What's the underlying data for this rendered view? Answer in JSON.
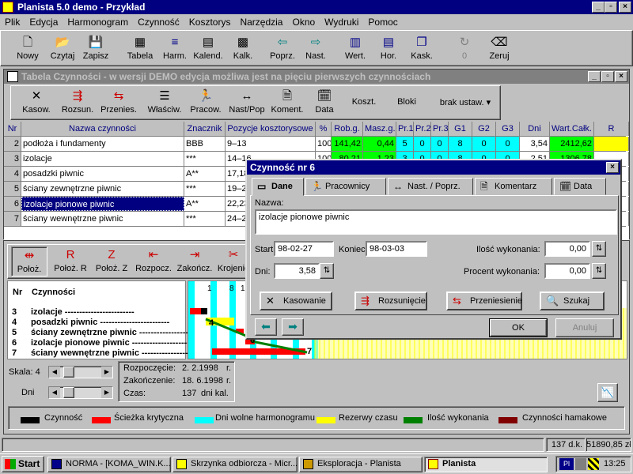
{
  "app": {
    "title": "Planista 5.0 demo - Przykład"
  },
  "menu": [
    "Plik",
    "Edycja",
    "Harmonogram",
    "Czynność",
    "Kosztorys",
    "Narzędzia",
    "Okno",
    "Wydruki",
    "Pomoc"
  ],
  "toolbar": [
    "Nowy",
    "Czytaj",
    "Zapisz",
    "Tabela",
    "Harm.",
    "Kalend.",
    "Kalk.",
    "Poprz.",
    "Nast.",
    "Wert.",
    "Hor.",
    "Kask.",
    "0",
    "Zeruj"
  ],
  "table_window": {
    "title": "Tabela Czynności - w wersji DEMO edycja możliwa jest na pięciu pierwszych czynnościach",
    "toolbar": [
      "Kasow.",
      "Rozsun.",
      "Przenies.",
      "Właściw.",
      "Pracow.",
      "Nast/Pop",
      "Koment.",
      "Data",
      "Koszt.",
      "Bloki"
    ],
    "filter": "brak ustaw.",
    "headers": [
      "Nr",
      "Nazwa czynności",
      "Znacznik",
      "Pozycje kosztorysowe",
      "%",
      "Rob.g.",
      "Masz.g.",
      "Pr.1",
      "Pr.2",
      "Pr.3",
      "G1",
      "G2",
      "G3",
      "Dni",
      "Wart.Całk.",
      "R"
    ],
    "rows": [
      {
        "nr": "2",
        "name": "podłoża i fundamenty",
        "tag": "BBB",
        "pos": "9–13",
        "pct": "100",
        "rob": "141,42",
        "masz": "0,44",
        "p1": "5",
        "p2": "0",
        "p3": "0",
        "g1": "8",
        "g2": "0",
        "g3": "0",
        "dni": "3,54",
        "wart": "2412,62"
      },
      {
        "nr": "3",
        "name": "izolacje",
        "tag": "***",
        "pos": "14–16",
        "pct": "100",
        "rob": "80,21",
        "masz": "1,23",
        "p1": "3",
        "p2": "0",
        "p3": "0",
        "g1": "8",
        "g2": "0",
        "g3": "0",
        "dni": "2,51",
        "wart": "1306,78"
      },
      {
        "nr": "4",
        "name": "posadzki piwnic",
        "tag": "A**",
        "pos": "17,18",
        "pct": "",
        "rob": "",
        "masz": "",
        "p1": "",
        "p2": "",
        "p3": "",
        "g1": "",
        "g2": "",
        "g3": "",
        "dni": "",
        "wart": ""
      },
      {
        "nr": "5",
        "name": "ściany zewnętrzne piwnic",
        "tag": "***",
        "pos": "19–2",
        "pct": "",
        "rob": "",
        "masz": "",
        "p1": "",
        "p2": "",
        "p3": "",
        "g1": "",
        "g2": "",
        "g3": "",
        "dni": "",
        "wart": ""
      },
      {
        "nr": "6",
        "name": "izolacje pionowe piwnic",
        "tag": "A**",
        "pos": "22,23",
        "pct": "",
        "rob": "",
        "masz": "",
        "p1": "",
        "p2": "",
        "p3": "",
        "g1": "",
        "g2": "",
        "g3": "",
        "dni": "",
        "wart": ""
      },
      {
        "nr": "7",
        "name": "ściany wewnętrzne piwnic",
        "tag": "***",
        "pos": "24–2",
        "pct": "",
        "rob": "",
        "masz": "",
        "p1": "",
        "p2": "",
        "p3": "",
        "g1": "",
        "g2": "",
        "g3": "",
        "dni": "",
        "wart": ""
      }
    ]
  },
  "gantt": {
    "toolbar": [
      "Położ.",
      "Położ. R",
      "Położ. Z",
      "Rozpocz.",
      "Zakończ.",
      "Krojenie"
    ],
    "headers": {
      "nr": "Nr",
      "name": "Czynności"
    },
    "rows": [
      {
        "nr": "3",
        "name": "izolacje"
      },
      {
        "nr": "4",
        "name": "posadzki piwnic"
      },
      {
        "nr": "5",
        "name": "ściany zewnętrzne piwnic"
      },
      {
        "nr": "6",
        "name": "izolacje pionowe piwnic"
      },
      {
        "nr": "7",
        "name": "ściany wewnętrzne piwnic"
      }
    ],
    "bar_labels": [
      "3",
      "4",
      "6",
      "7"
    ],
    "top_marks": [
      "1",
      "8",
      "1"
    ],
    "scale_label": "Skala: 4",
    "days_label": "Dni",
    "info": {
      "start_label": "Rozpoczęcie:",
      "start": "2. 2.1998",
      "start_unit": "r.",
      "end_label": "Zakończenie:",
      "end": "18. 6.1998",
      "end_unit": "r.",
      "time_label": "Czas:",
      "time": "137",
      "time_unit": "dni kal."
    },
    "legend": [
      {
        "label": "Czynność",
        "color": "#000000"
      },
      {
        "label": "Ścieżka krytyczna",
        "color": "#ff0000"
      },
      {
        "label": "Dni wolne harmonogramu",
        "color": "#00ffff"
      },
      {
        "label": "Rezerwy czasu",
        "color": "#ffff00"
      },
      {
        "label": "Ilość wykonania",
        "color": "#008000"
      },
      {
        "label": "Czynności hamakowe",
        "color": "#800000"
      }
    ]
  },
  "dialog": {
    "title": "Czynność nr 6",
    "tabs": [
      "Dane",
      "Pracownicy",
      "Nast. / Poprz.",
      "Komentarz",
      "Data"
    ],
    "name_label": "Nazwa:",
    "name_value": "izolacje pionowe piwnic",
    "start_label": "Start",
    "start_value": "98-02-27",
    "end_label": "Koniec:",
    "end_value": "98-03-03",
    "days_label": "Dni:",
    "days_value": "3,58",
    "qty_label": "Ilość wykonania:",
    "qty_value": "0,00",
    "pct_label": "Procent wykonania:",
    "pct_value": "0,00",
    "buttons": [
      "Kasowanie",
      "Rozsunięcie",
      "Przeniesienie",
      "Szukaj"
    ],
    "ok": "OK",
    "cancel": "Anuluj"
  },
  "status": {
    "days": "137 d.k.",
    "value": "51890,85 zł"
  },
  "taskbar": {
    "start": "Start",
    "tasks": [
      "NORMA - [KOMA_WIN.K...",
      "Skrzynka odbiorcza - Micr...",
      "Eksploracja - Planista",
      "Planista"
    ],
    "tray": "Pl",
    "time": "13:25"
  }
}
